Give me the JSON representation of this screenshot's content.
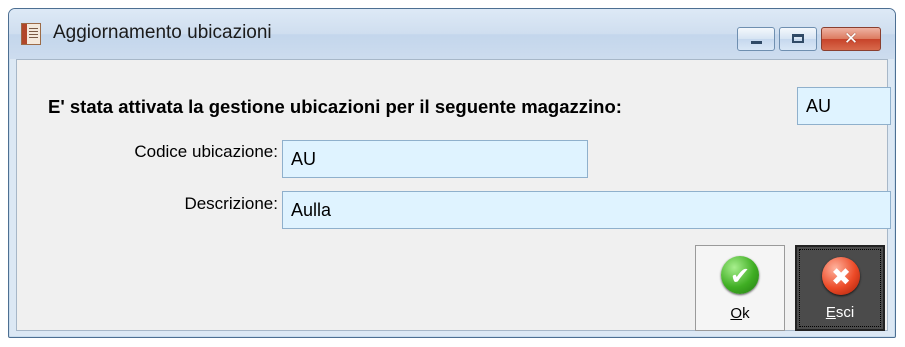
{
  "window": {
    "title": "Aggiornamento ubicazioni",
    "icon": "document-app-icon",
    "controls": {
      "minimize": "minimize-icon",
      "maximize": "maximize-icon",
      "close_glyph": "✕"
    }
  },
  "form": {
    "message_label": "E' stata attivata la gestione ubicazioni per il seguente magazzino:",
    "magazzino_value": "AU",
    "codice_label": "Codice ubicazione:",
    "codice_value": "AU",
    "descrizione_label": "Descrizione:",
    "descrizione_value": "Aulla"
  },
  "buttons": {
    "ok": {
      "mnemonic": "O",
      "rest": "k",
      "icon": "check-icon",
      "glyph": "✔"
    },
    "esci": {
      "mnemonic": "E",
      "rest": "sci",
      "icon": "x-icon",
      "glyph": "✖"
    }
  },
  "colors": {
    "field_bg": "#dff3ff",
    "ok_icon": "#3fae23",
    "esci_icon": "#ec4a27",
    "esci_button_bg": "#4b4b4b"
  }
}
